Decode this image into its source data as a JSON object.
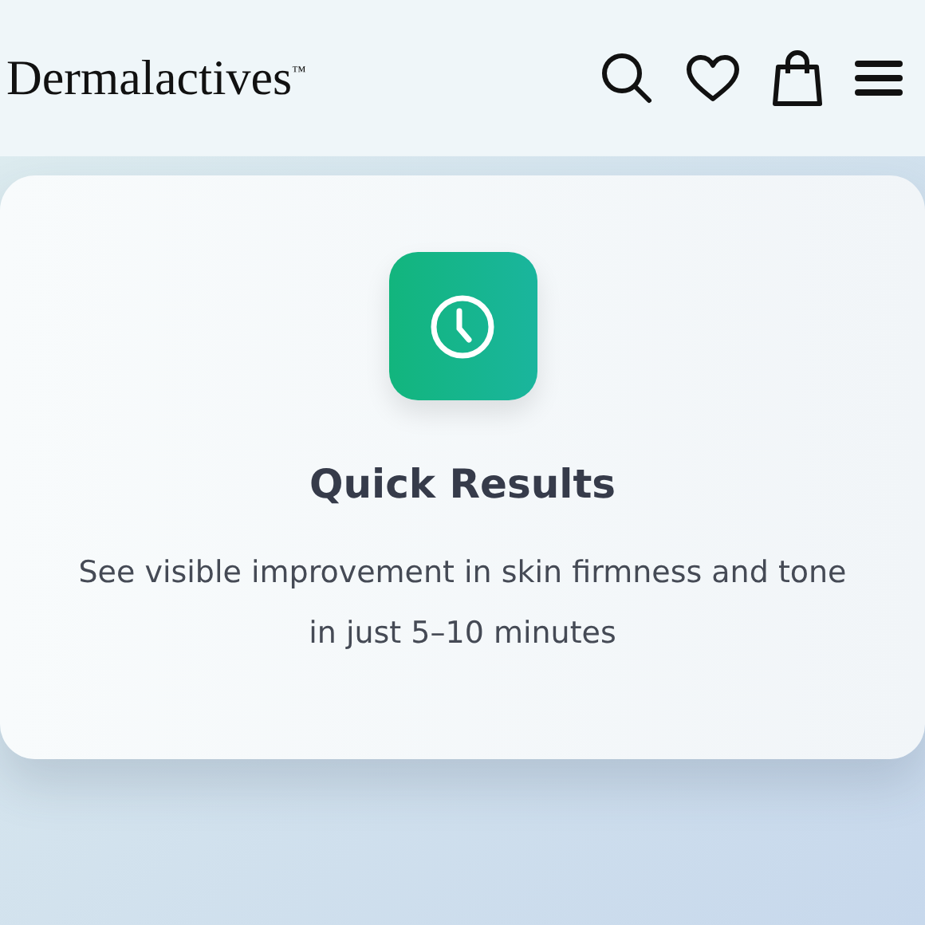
{
  "header": {
    "logo": "Dermalactives$^{™}$"
  },
  "feature_card": {
    "title": "Quick Results",
    "description": "See visible improvement in skin firmness and tone in just 5–10 minutes"
  }
}
